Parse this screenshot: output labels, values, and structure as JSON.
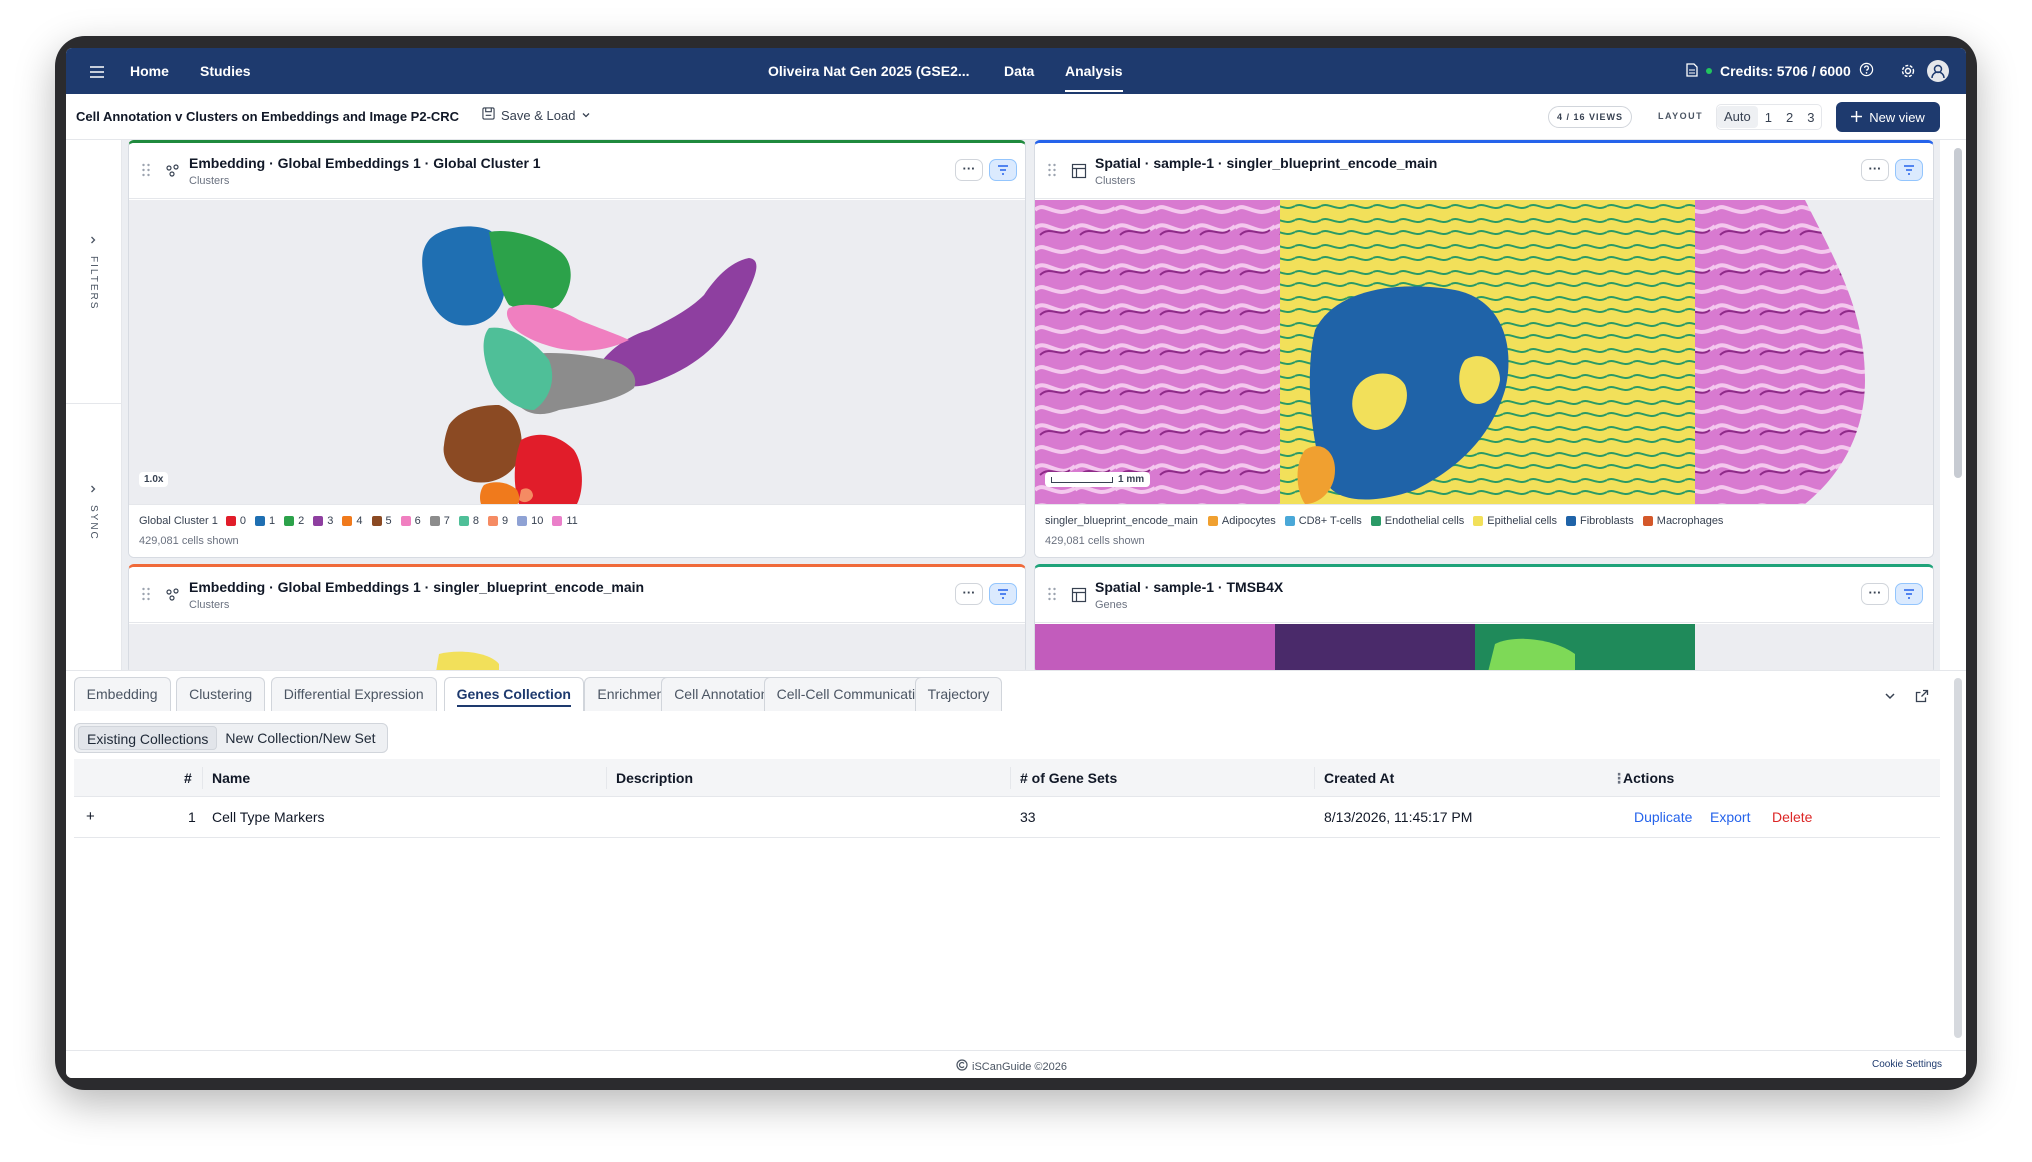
{
  "nav": {
    "home": "Home",
    "studies": "Studies",
    "study_title": "Oliveira Nat Gen 2025 (GSE2...",
    "data": "Data",
    "analysis": "Analysis",
    "credits": "Credits: 5706 / 6000"
  },
  "toolbar": {
    "analysis_title": "Cell Annotation v Clusters on Embeddings and Image P2-CRC",
    "save_load": "Save & Load",
    "views_count": "4 / 16 VIEWS",
    "layout_label": "LAYOUT",
    "layout_options": [
      "Auto",
      "1",
      "2",
      "3"
    ],
    "new_view": "New view"
  },
  "sidebar": {
    "filters": "FILTERS",
    "sync": "SYNC"
  },
  "panels": [
    {
      "title": "Embedding · Global Embeddings 1 · Global Cluster 1",
      "subtitle": "Clusters",
      "zoom": "1.0x",
      "legend_title": "Global Cluster 1",
      "legend": [
        {
          "label": "0",
          "color": "#e11d2a"
        },
        {
          "label": "1",
          "color": "#1f6fb2"
        },
        {
          "label": "2",
          "color": "#2ca24a"
        },
        {
          "label": "3",
          "color": "#8e3fa0"
        },
        {
          "label": "4",
          "color": "#f07a1c"
        },
        {
          "label": "5",
          "color": "#8b4a23"
        },
        {
          "label": "6",
          "color": "#f07fc0"
        },
        {
          "label": "7",
          "color": "#8c8c8c"
        },
        {
          "label": "8",
          "color": "#4fbf98"
        },
        {
          "label": "9",
          "color": "#f58b63"
        },
        {
          "label": "10",
          "color": "#8fa2d4"
        },
        {
          "label": "11",
          "color": "#ea7fc9"
        }
      ],
      "cells": "429,081 cells shown",
      "accent": "#1f8a3d"
    },
    {
      "title": "Spatial · sample-1 · singler_blueprint_encode_main",
      "subtitle": "Clusters",
      "scale": "1 mm",
      "legend_title": "singler_blueprint_encode_main",
      "legend": [
        {
          "label": "Adipocytes",
          "color": "#f0a030"
        },
        {
          "label": "CD8+ T-cells",
          "color": "#4aa8d8"
        },
        {
          "label": "Endothelial cells",
          "color": "#2a9a66"
        },
        {
          "label": "Epithelial cells",
          "color": "#f2e05a"
        },
        {
          "label": "Fibroblasts",
          "color": "#1f63a8"
        },
        {
          "label": "Macrophages",
          "color": "#d4582a"
        }
      ],
      "cells": "429,081 cells shown",
      "accent": "#2563eb"
    },
    {
      "title": "Embedding · Global Embeddings 1 · singler_blueprint_encode_main",
      "subtitle": "Clusters",
      "accent": "#f06a3a"
    },
    {
      "title": "Spatial · sample-1 · TMSB4X",
      "subtitle": "Genes",
      "accent": "#1fa37a"
    }
  ],
  "tabs": [
    "Embedding",
    "Clustering",
    "Differential Expression",
    "Genes Collection",
    "Enrichment",
    "Cell Annotation",
    "Cell-Cell Communication",
    "Trajectory"
  ],
  "active_tab": "Genes Collection",
  "subtabs": [
    "Existing Collections",
    "New Collection/New Set"
  ],
  "table": {
    "headers": [
      "#",
      "Name",
      "Description",
      "# of Gene Sets",
      "Created At",
      "Actions"
    ],
    "rows": [
      {
        "expand": "+",
        "index": "1",
        "name": "Cell Type Markers",
        "description": "",
        "gene_sets": "33",
        "created_at": "8/13/2026, 11:45:17 PM"
      }
    ],
    "actions": [
      "Duplicate",
      "Export",
      "Delete"
    ]
  },
  "footer": {
    "brand": "iSCanGuide ©2026",
    "cookie": "Cookie Settings"
  }
}
